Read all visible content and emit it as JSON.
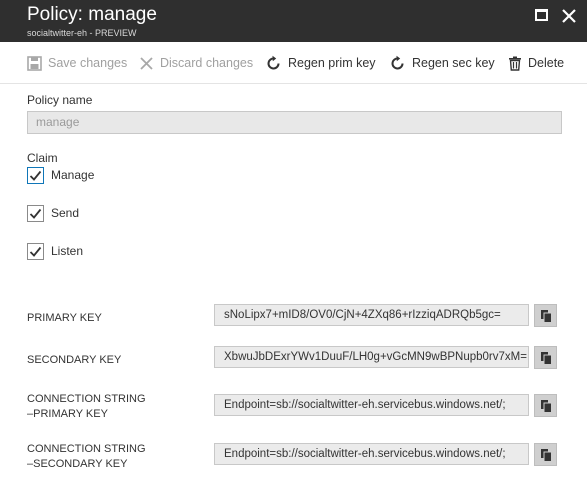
{
  "header": {
    "title": "Policy: manage",
    "subtitle": "socialtwitter-eh - PREVIEW"
  },
  "toolbar": {
    "save_label": "Save changes",
    "discard_label": "Discard changes",
    "regen_prim_label": "Regen prim key",
    "regen_sec_label": "Regen sec key",
    "delete_label": "Delete"
  },
  "form": {
    "policy_name_label": "Policy name",
    "policy_name_value": "manage",
    "claim_label": "Claim",
    "claims": [
      {
        "label": "Manage",
        "checked": true
      },
      {
        "label": "Send",
        "checked": true
      },
      {
        "label": "Listen",
        "checked": true
      }
    ]
  },
  "keys": {
    "primary_key_label": "PRIMARY KEY",
    "primary_key_value": "sNoLipx7+mID8/OV0/CjN+4ZXq86+rIzziqADRQb5gc=",
    "secondary_key_label": "SECONDARY KEY",
    "secondary_key_value": "XbwuJbDExrYWv1DuuF/LH0g+vGcMN9wBPNupb0rv7xM=",
    "conn_primary_label_1": "CONNECTION STRING",
    "conn_primary_label_2": "–PRIMARY KEY",
    "conn_primary_value": "Endpoint=sb://socialtwitter-eh.servicebus.windows.net/;",
    "conn_secondary_label_1": "CONNECTION STRING",
    "conn_secondary_label_2": "–SECONDARY KEY",
    "conn_secondary_value": "Endpoint=sb://socialtwitter-eh.servicebus.windows.net/;"
  },
  "icons": {
    "maximize": "maximize-icon",
    "close": "close-icon",
    "save": "save-icon",
    "discard": "x-icon",
    "regen": "refresh-icon",
    "delete": "trash-icon",
    "copy": "copy-icon",
    "check": "checkmark-icon"
  },
  "colors": {
    "title_bar": "#2f2f2f",
    "focus_border": "#0f76b8",
    "disabled_text": "#a0a0a0",
    "field_bg": "#ebebeb",
    "copy_button_bg": "#cfcfcf"
  }
}
